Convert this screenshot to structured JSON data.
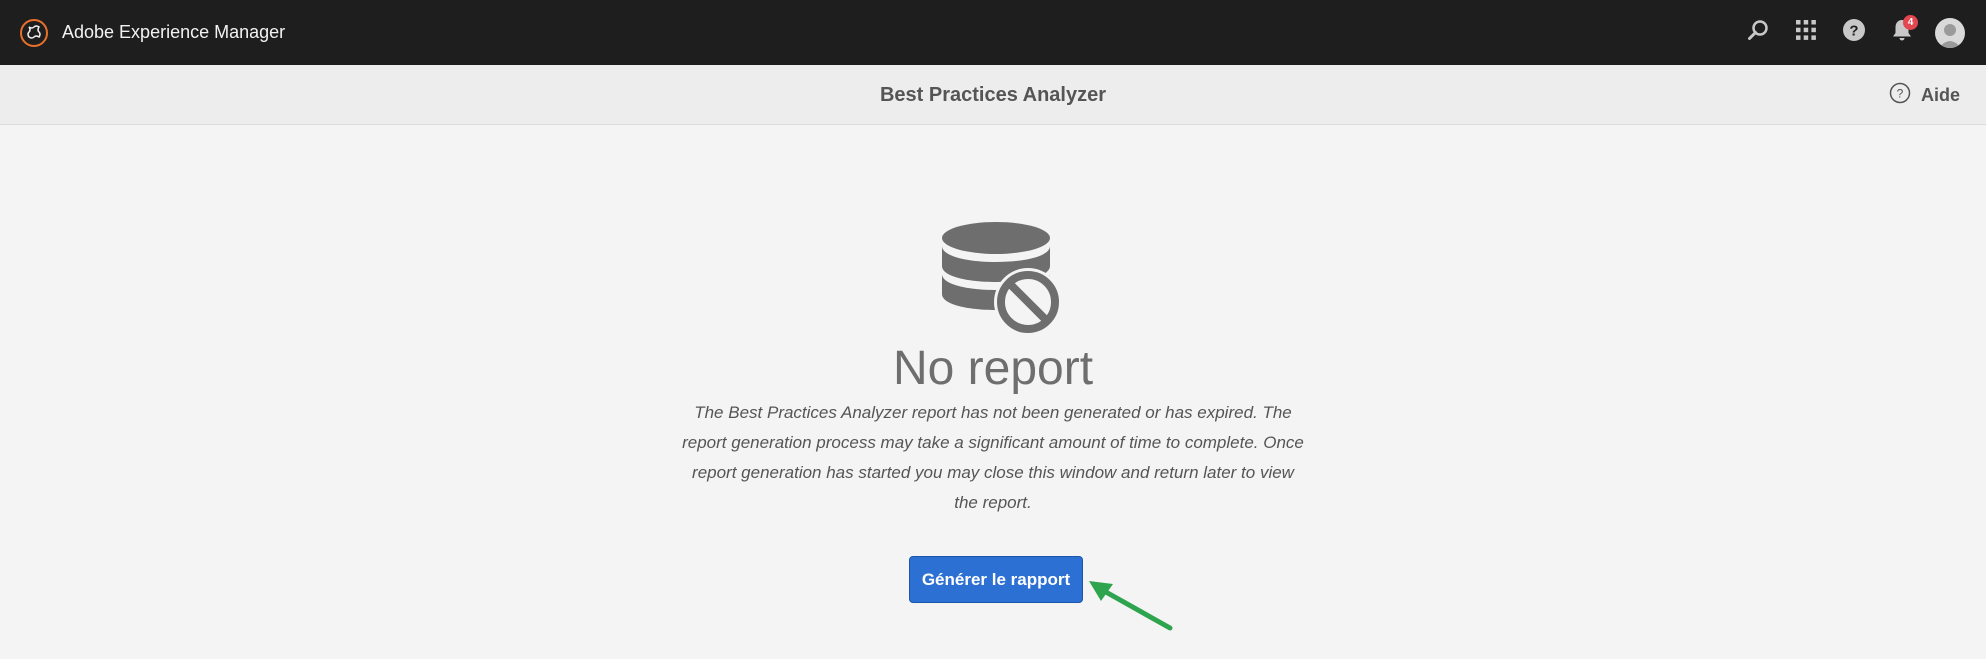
{
  "shell": {
    "app_title": "Adobe Experience Manager",
    "icons": [
      "adobe-logo-icon",
      "search-icon",
      "apps-grid-icon",
      "help-icon",
      "bell-icon",
      "user-avatar-icon"
    ],
    "notification_count": "4",
    "badge_color": "#e34850",
    "background": "#1e1e1e"
  },
  "actionbar": {
    "title": "Best Practices Analyzer",
    "help_label": "Aide"
  },
  "empty_state": {
    "icon": "database-blocked-icon",
    "heading": "No report",
    "description": "The Best Practices Analyzer report has not been generated or has expired. The report generation process may take a significant amount of time to complete. Once report generation has started you may close this window and return later to view the report.",
    "button_label": "Générer le rapport",
    "button_color": "#2c70d3"
  },
  "annotation": {
    "arrow_color": "#2ea44f"
  }
}
